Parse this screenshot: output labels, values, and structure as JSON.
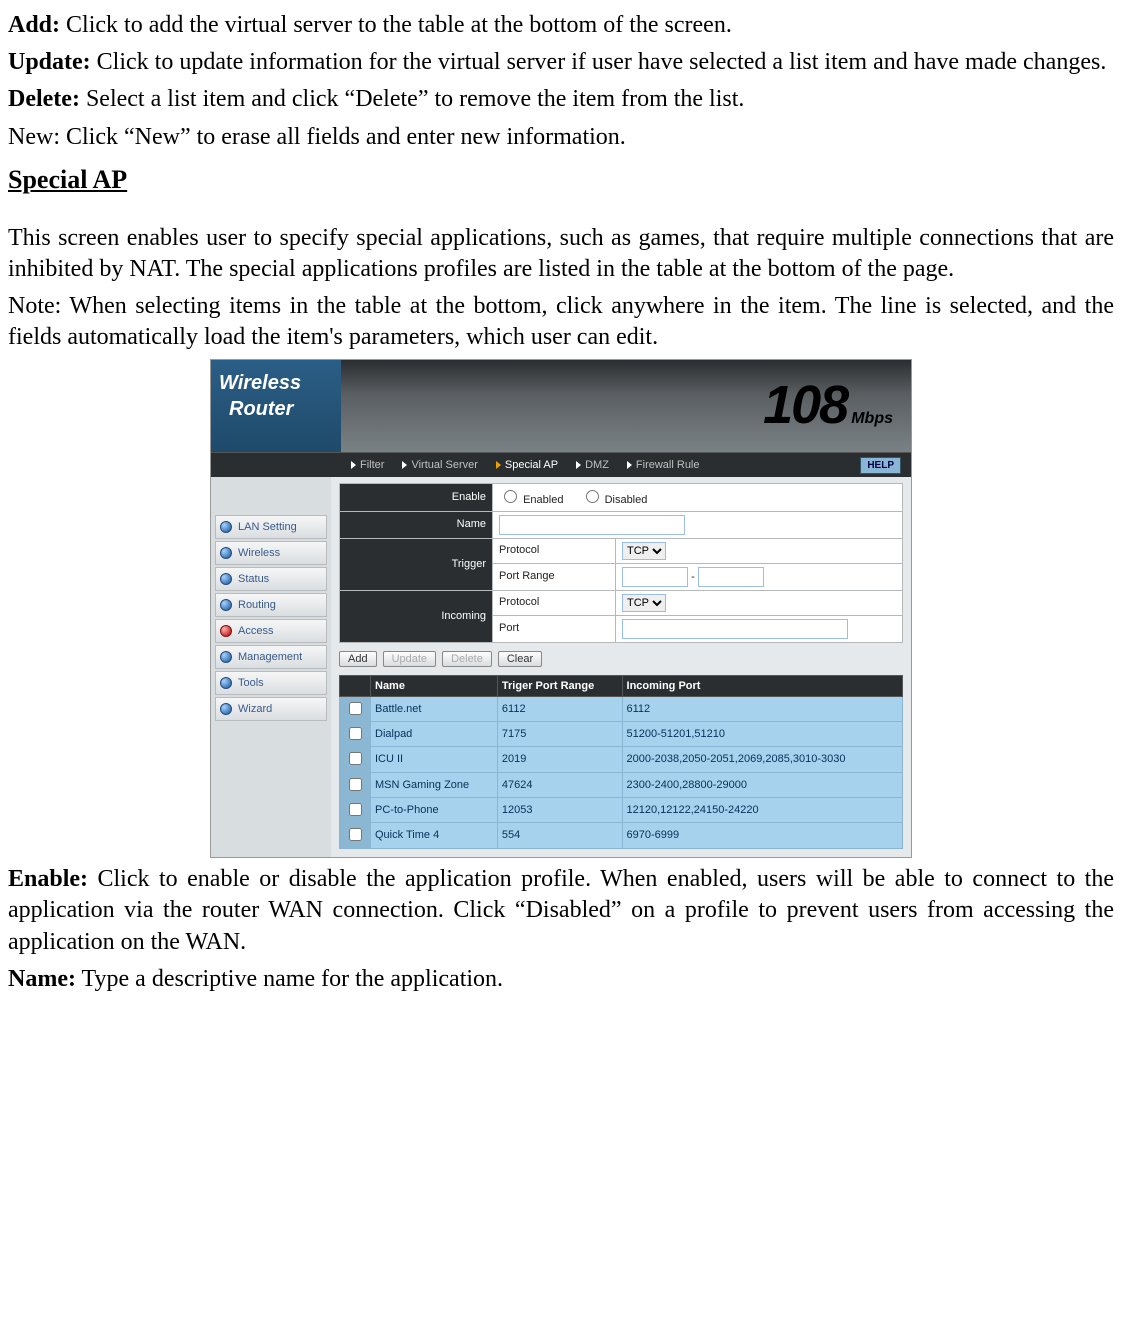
{
  "doc": {
    "add_label": "Add:",
    "add_desc": " Click to add the virtual server to the table at the bottom of the screen.",
    "update_label": "Update:",
    "update_desc": " Click to update information for the virtual server if  user have selected a list item and have made changes.",
    "delete_label": "Delete:",
    "delete_desc": " Select a list item and click “Delete” to remove the item from the list.",
    "new_desc": "New: Click “New” to erase all fields and enter new information.",
    "heading": "Special AP",
    "special_desc": "This screen enables user to specify special applications, such as games, that require multiple connections that are inhibited by NAT. The special applications profiles are listed in the table at the bottom of the page.",
    "note": "Note: When selecting items in the table at the bottom, click anywhere in the item. The line is selected, and the fields automatically load the item's parameters, which user can edit.",
    "enable_label": "Enable:",
    "enable_desc": " Click to enable or disable the application profile. When enabled, users will be able to connect to the application via the router WAN connection. Click “Disabled” on a profile to prevent users from accessing the application on the WAN.",
    "name_label": "Name:",
    "name_desc": " Type a descriptive name for the application."
  },
  "banner": {
    "line1": "Wireless",
    "line2": "Router",
    "num": "108",
    "unit": "Mbps"
  },
  "tabs": [
    "Filter",
    "Virtual Server",
    "Special AP",
    "DMZ",
    "Firewall Rule"
  ],
  "help": "HELP",
  "sidebar": [
    "LAN Setting",
    "Wireless",
    "Status",
    "Routing",
    "Access",
    "Management",
    "Tools",
    "Wizard"
  ],
  "form": {
    "enable_label": "Enable",
    "enabled": "Enabled",
    "disabled": "Disabled",
    "name_label": "Name",
    "trigger_label": "Trigger",
    "incoming_label": "Incoming",
    "protocol": "Protocol",
    "port_range": "Port Range",
    "port": "Port",
    "tcp": "TCP",
    "dash": "-"
  },
  "buttons": {
    "add": "Add",
    "update": "Update",
    "delete": "Delete",
    "clear": "Clear"
  },
  "table_headers": {
    "name": "Name",
    "trigger": "Triger Port Range",
    "incoming": "Incoming Port"
  },
  "chart_data": {
    "type": "table",
    "columns": [
      "Name",
      "Triger Port Range",
      "Incoming Port"
    ],
    "rows": [
      {
        "name": "Battle.net",
        "trigger": "6112",
        "incoming": "6112"
      },
      {
        "name": "Dialpad",
        "trigger": "7175",
        "incoming": "51200-51201,51210"
      },
      {
        "name": "ICU II",
        "trigger": "2019",
        "incoming": "2000-2038,2050-2051,2069,2085,3010-3030"
      },
      {
        "name": "MSN Gaming Zone",
        "trigger": "47624",
        "incoming": "2300-2400,28800-29000"
      },
      {
        "name": "PC-to-Phone",
        "trigger": "12053",
        "incoming": "12120,12122,24150-24220"
      },
      {
        "name": "Quick Time 4",
        "trigger": "554",
        "incoming": "6970-6999"
      }
    ]
  }
}
